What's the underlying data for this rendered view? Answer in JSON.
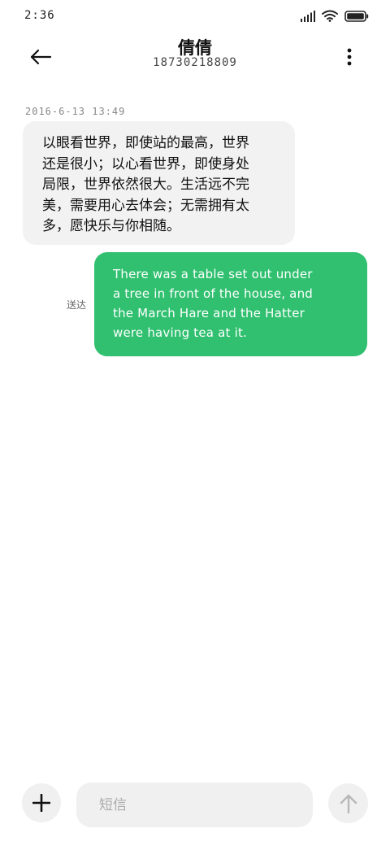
{
  "status_bar": {
    "time": "2:36",
    "icons": [
      "signal-icon",
      "wifi-icon",
      "battery-icon"
    ]
  },
  "header": {
    "contact_name": "倩倩",
    "contact_number": "18730218809",
    "back_icon": "back-arrow-icon",
    "more_icon": "more-vertical-icon"
  },
  "conversation": {
    "timestamp": "2016-6-13 13:49",
    "incoming_message": {
      "lines": [
        "以眼看世界，即使站的最高，世界",
        "还是很小；以心看世界，即使身处",
        "局限，世界依然很大。生活远不完",
        "美，需要用心去体会；无需拥有太",
        "多，愿快乐与你相随。"
      ]
    },
    "outgoing_message": {
      "status": "送达",
      "lines": [
        "There was a table set out under",
        "a tree in front of the house, and",
        "the March Hare and the Hatter",
        "were having tea at it."
      ]
    }
  },
  "composer": {
    "add_icon": "plus-icon",
    "input_placeholder": "短信",
    "input_value": "",
    "send_icon": "arrow-up-icon"
  },
  "colors": {
    "outgoing_bubble": "#30c070",
    "incoming_bubble": "#f2f2f2",
    "composer_background": "#f0f0f0"
  }
}
